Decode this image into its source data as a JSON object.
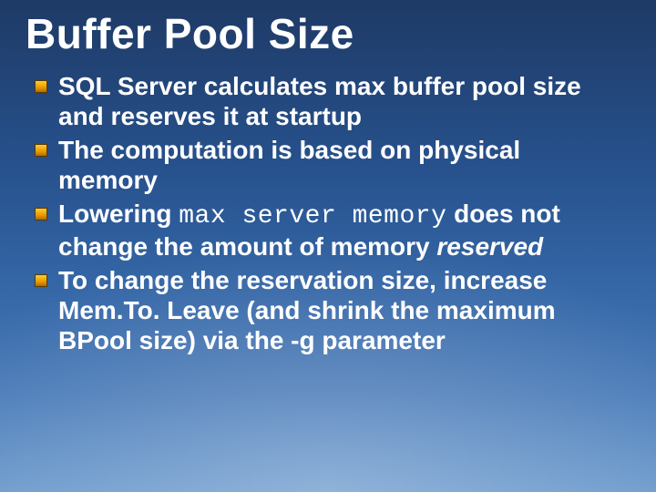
{
  "slide": {
    "title": "Buffer Pool Size",
    "bullets": [
      {
        "pre": "SQL Server calculates max buffer pool size and reserves it at startup"
      },
      {
        "pre": "The computation is based on physical memory"
      },
      {
        "pre": "Lowering ",
        "code": "max server memory",
        "mid": " does not change the amount of memory ",
        "emph": "reserved"
      },
      {
        "pre": "To change the reservation size, increase Mem.To. Leave (and shrink the maximum BPool size) via the -g parameter"
      }
    ]
  }
}
